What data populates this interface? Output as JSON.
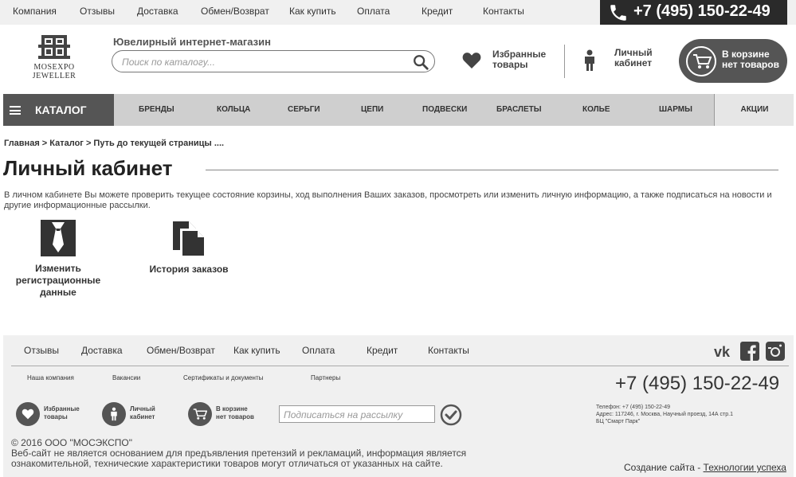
{
  "topnav": {
    "items": [
      "Компания",
      "Отзывы",
      "Доставка",
      "Обмен/Возврат",
      "Как купить",
      "Оплата",
      "Кредит",
      "Контакты"
    ],
    "phone": "+7 (495) 150-22-49"
  },
  "header": {
    "logo_line1": "MOSEXPO",
    "logo_line2": "JEWELLER",
    "shop_title": "Ювелирный интернет-магазин",
    "search_placeholder": "Поиск по каталогу...",
    "favorites": [
      "Избранные",
      "товары"
    ],
    "account": [
      "Личный",
      "кабинет"
    ],
    "cart": [
      "В корзине",
      "нет товаров"
    ]
  },
  "catnav": {
    "catalog_label": "КАТАЛОГ",
    "items": [
      "БРЕНДЫ",
      "КОЛЬЦА",
      "СЕРЬГИ",
      "ЦЕПИ",
      "ПОДВЕСКИ",
      "БРАСЛЕТЫ",
      "КОЛЬЕ",
      "ШАРМЫ"
    ],
    "promo": "АКЦИИ"
  },
  "content": {
    "breadcrumb": "Главная > Каталог > Путь до текущей страницы ....",
    "title": "Личный кабинет",
    "intro": "В личном кабинете Вы можете проверить текущее состояние корзины, ход выполнения Ваших заказов, просмотреть или изменить личную информацию, а также подписаться на новости и другие информационные рассылки.",
    "tiles": [
      {
        "label": "Изменить регистрационные данные",
        "icon": "tie-icon"
      },
      {
        "label": "История заказов",
        "icon": "documents-icon"
      }
    ]
  },
  "footer": {
    "nav": [
      "Отзывы",
      "Доставка",
      "Обмен/Возврат",
      "Как купить",
      "Оплата",
      "Кредит",
      "Контакты"
    ],
    "nav2": [
      "Наша компания",
      "Вакансии",
      "Сертификаты и документы",
      "Партнеры"
    ],
    "social": [
      "vk-icon",
      "facebook-icon",
      "instagram-icon"
    ],
    "phone": "+7 (495) 150-22-49",
    "info_line1": "Телефон: +7 (495) 150-22-49",
    "info_line2": "Адрес: 117246, г. Москва, Научный проезд, 14А стр.1",
    "info_line3": "БЦ \"Смарт Парк\"",
    "favorites": [
      "Избранные",
      "товары"
    ],
    "account": [
      "Личный",
      "кабинет"
    ],
    "cart": [
      "В корзине",
      "нет товаров"
    ],
    "subscribe_placeholder": "Подписаться на рассылку",
    "copyright": "© 2016 ООО \"МОСЭКСПО\"",
    "disclaimer": "Веб-сайт не является основанием для предъявления претензий и рекламаций, информация является ознакомительной, технические характеристики товаров могут отличаться от указанных на сайте.",
    "dev_prefix": "Создание сайта - ",
    "dev_link": "Технологии успеха"
  },
  "colors": {
    "dark": "#2a2a2a",
    "accent_gray": "#555555",
    "nav_bg": "#cfcfcf",
    "light_bg": "#f0f0f0"
  }
}
